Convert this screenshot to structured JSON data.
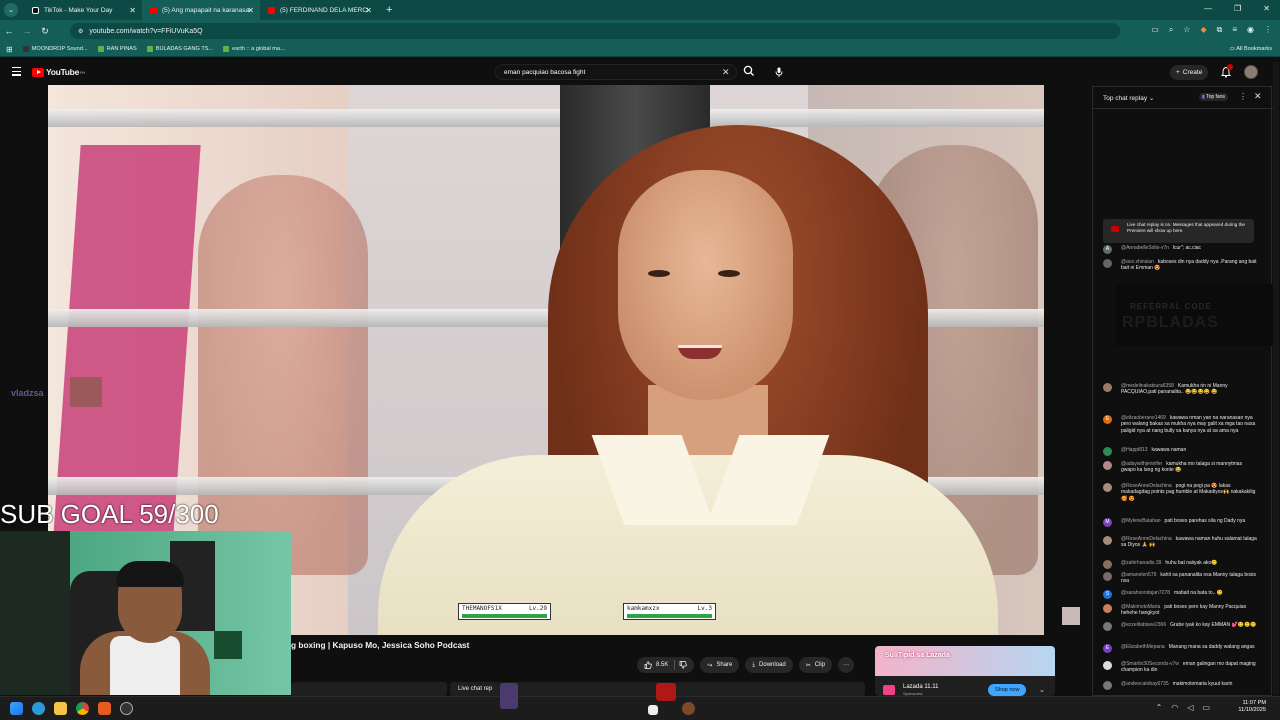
{
  "browser": {
    "tabs": [
      {
        "label": "TikTok - Make Your Day",
        "favicon_color": "#111111"
      },
      {
        "label": "(5) Ang mapapait na karanasan",
        "favicon_color": "#ff0000"
      },
      {
        "label": "(5) FERDINAND DELA MERCED",
        "favicon_color": "#ff0000"
      }
    ],
    "url": "youtube.com/watch?v=FFiUVuKa5Q",
    "bookmarks": [
      "MOONDROP Sound...",
      "RAN PINAS",
      "BULADAS GANG TS...",
      "earth :: a global ma..."
    ],
    "all_bookmarks_label": "All Bookmarks"
  },
  "youtube": {
    "logo_text": "YouTube",
    "logo_region": "PH",
    "search_query": "eman pacquiao bacosa fight",
    "create_label": "Create",
    "notification_count": "9+"
  },
  "video": {
    "title_visible": "g boxing | Kapuso Mo, Jessica Soho Podcast",
    "like_count": "8.5K",
    "share_label": "Share",
    "download_label": "Download",
    "clip_label": "Clip",
    "live_chat_label": "Live chat rep"
  },
  "stream_overlay": {
    "sub_goal": "SUB GOAL 59/300",
    "viewer_name": "vladzsa",
    "hp_left": {
      "name": "THEMANOFS1X",
      "level": "Lv.29",
      "fill": 1.0
    },
    "hp_right": {
      "name": "kamkamxzx",
      "level": "Lv.3",
      "fill": 1.0
    }
  },
  "ad": {
    "headline": "SuliTipid sa Lazada",
    "brand": "Lazada 11.11",
    "sub": "Sponsored",
    "cta": "Shop now"
  },
  "chat": {
    "title": "Top chat replay",
    "top_fans_label": "Top fans",
    "replay_notice": "Live chat replay is on. Messages that appeared during the Premiere will show up here.",
    "overlay_line1": "REFERRAL CODE",
    "overlay_line2": "RPBLADAS",
    "messages": [
      {
        "author": "@AnnabelleSolis-v7n",
        "text": "lcur\"; ac.ciac",
        "avatar": "A",
        "color": "#5f6f66"
      },
      {
        "author": "@ace.shinsian",
        "text": "kaboses din nya daddy nya .Parang ang bait bait ni Emman 😍",
        "avatar": "",
        "color": "#666666"
      },
      {
        "author": "@medelinakatsura6358",
        "text": "Kamukha rin ni Manny PACQUIAO,pati pananalita.. 😂😂😂😂 😂",
        "avatar": "",
        "color": "#9c7a6a"
      },
      {
        "author": "@elizaoberano1469",
        "text": "kawawa nman yan na naranasan nya pero walang bakas sa mukha nya may galit xa mga tao nasa paligid nya at nang bully xa kanya nya at sa ama nya",
        "avatar": "E",
        "color": "#e26b0a"
      },
      {
        "author": "@Happi813",
        "text": "kawawa naman",
        "avatar": "",
        "color": "#2e8b57"
      },
      {
        "author": "@adaywithjennifer",
        "text": "kamukha mo talaga si mannytmas gwapo ka lang ng konte 😂",
        "avatar": "",
        "color": "#b08a8a"
      },
      {
        "author": "@RoseAnneDelachina",
        "text": "pogi na pogi pa 😍 lakas makadagdag points pag humble at Makadiyos🙌 nakakakilig🥰 😍",
        "avatar": "",
        "color": "#a58c7b"
      },
      {
        "author": "@MyleneBulahao",
        "text": "pati boses parehas sila ng Dady nya",
        "avatar": "M",
        "color": "#7b3fbf"
      },
      {
        "author": "@RoseAnneDelachina",
        "text": "kawawa naman huhu salamat talaga sa Diyos 🙏 🙌",
        "avatar": "",
        "color": "#a58c7b"
      },
      {
        "author": "@zahirhanadis.39",
        "text": "huhu bat naiiyak ako🥲",
        "avatar": "",
        "color": "#8a6f5d"
      },
      {
        "author": "@amanelen579",
        "text": "kahit sa pananalita nsa Manny talaga bosis nsa",
        "avatar": "",
        "color": "#7a6a6a"
      },
      {
        "author": "@sarahsondajan7278",
        "text": "mabait na bata to.. 😊",
        "avatar": "S",
        "color": "#1a73e8"
      },
      {
        "author": "@MakimotoMaria",
        "text": "pati boses pero kay Manny Pacquiao hehehe hangkyot",
        "avatar": "",
        "color": "#c9805a"
      },
      {
        "author": "@ezzelitabisee2366",
        "text": "Grabe iyak ko kay EMMAN 💕🥲🥲🥲",
        "avatar": "",
        "color": "#777777"
      },
      {
        "author": "@ElizabethMepana",
        "text": "Manang mana sa daddy walang angas",
        "avatar": "E",
        "color": "#7b3fbf"
      },
      {
        "author": "@Smartin30Seconds-v7w",
        "text": "eman galingan mo dapat maging champion ka din",
        "avatar": "",
        "color": "#dddddd"
      },
      {
        "author": "@andeecatobay6735",
        "text": "makimotomaria kyuut karin",
        "avatar": "",
        "color": "#777777"
      }
    ]
  },
  "taskbar": {
    "time": "11:07 PM",
    "date": "11/10/2025"
  }
}
